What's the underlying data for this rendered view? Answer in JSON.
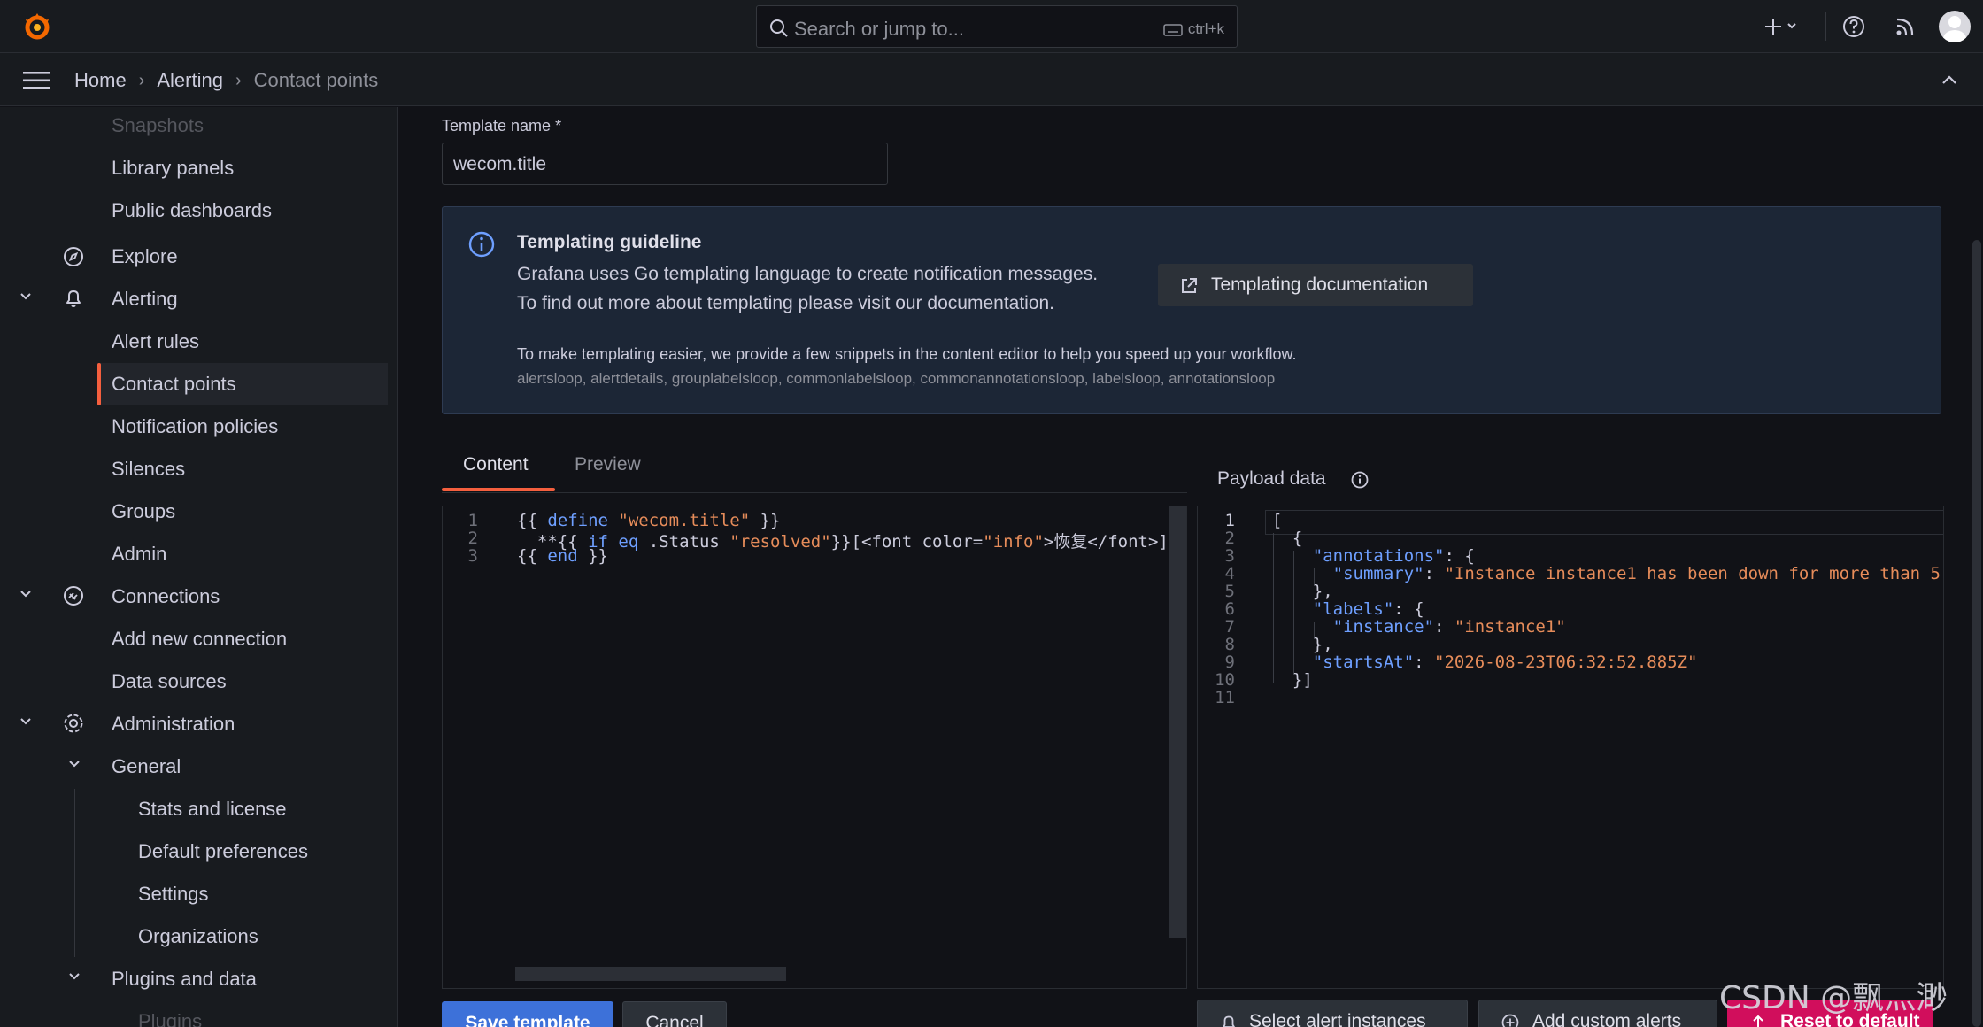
{
  "topbar": {
    "search_placeholder": "Search or jump to...",
    "search_shortcut": "ctrl+k"
  },
  "breadcrumb": {
    "items": [
      "Home",
      "Alerting",
      "Contact points"
    ]
  },
  "sidebar": {
    "items": [
      {
        "label": "Snapshots",
        "icon": ""
      },
      {
        "label": "Library panels",
        "icon": ""
      },
      {
        "label": "Public dashboards",
        "icon": ""
      },
      {
        "label": "Explore",
        "icon": "compass-icon"
      },
      {
        "label": "Alerting",
        "icon": "bell-icon"
      },
      {
        "label": "Alert rules",
        "icon": ""
      },
      {
        "label": "Contact points",
        "icon": "",
        "active": true
      },
      {
        "label": "Notification policies",
        "icon": ""
      },
      {
        "label": "Silences",
        "icon": ""
      },
      {
        "label": "Groups",
        "icon": ""
      },
      {
        "label": "Admin",
        "icon": ""
      },
      {
        "label": "Connections",
        "icon": "connections-icon"
      },
      {
        "label": "Add new connection",
        "icon": ""
      },
      {
        "label": "Data sources",
        "icon": ""
      },
      {
        "label": "Administration",
        "icon": "cog-icon"
      },
      {
        "label": "General",
        "icon": ""
      },
      {
        "label": "Stats and license",
        "icon": ""
      },
      {
        "label": "Default preferences",
        "icon": ""
      },
      {
        "label": "Settings",
        "icon": ""
      },
      {
        "label": "Organizations",
        "icon": ""
      },
      {
        "label": "Plugins and data",
        "icon": ""
      },
      {
        "label": "Plugins",
        "icon": ""
      }
    ]
  },
  "form": {
    "template_name_label": "Template name *",
    "template_name_value": "wecom.title"
  },
  "guideline": {
    "title": "Templating guideline",
    "line1": "Grafana uses Go templating language to create notification messages.",
    "line2": "To find out more about templating please visit our documentation.",
    "doc_button": "Templating documentation",
    "snippet_intro": "To make templating easier, we provide a few snippets in the content editor to help you speed up your workflow.",
    "snippet_list": "alertsloop, alertdetails, grouplabelsloop, commonlabelsloop, commonannotationsloop, labelsloop, annotationsloop"
  },
  "tabs": {
    "content": "Content",
    "preview": "Preview"
  },
  "editor": {
    "line_numbers": [
      "1",
      "2",
      "3"
    ]
  },
  "payload": {
    "title": "Payload data",
    "line_numbers": [
      "1",
      "2",
      "3",
      "4",
      "5",
      "6",
      "7",
      "8",
      "9",
      "10",
      "11"
    ]
  },
  "buttons": {
    "save": "Save template",
    "cancel": "Cancel",
    "select_alerts": "Select alert instances",
    "add_custom": "Add custom alerts",
    "reset": "Reset to default"
  },
  "watermark": "CSDN @飘灬渺",
  "colors": {
    "accent": "#f55f3e",
    "primary": "#3d71d9",
    "destructive": "#d10e5c",
    "keyword": "#6e9fff",
    "string": "#e68c5a"
  }
}
